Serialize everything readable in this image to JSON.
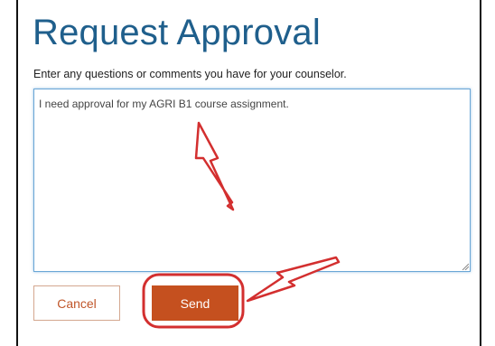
{
  "dialog": {
    "title": "Request Approval",
    "prompt": "Enter any questions or comments you have for your counselor.",
    "message_value": "I need approval for my AGRI B1 course assignment.",
    "cancel_label": "Cancel",
    "send_label": "Send"
  },
  "colors": {
    "title": "#1f5f8c",
    "send_button": "#c5501f",
    "cancel_text": "#c0562a",
    "annotation": "#d32f2f"
  },
  "annotations": {
    "icons": [
      "up-arrow-annotation",
      "left-arrow-annotation",
      "send-highlight-ring"
    ]
  }
}
